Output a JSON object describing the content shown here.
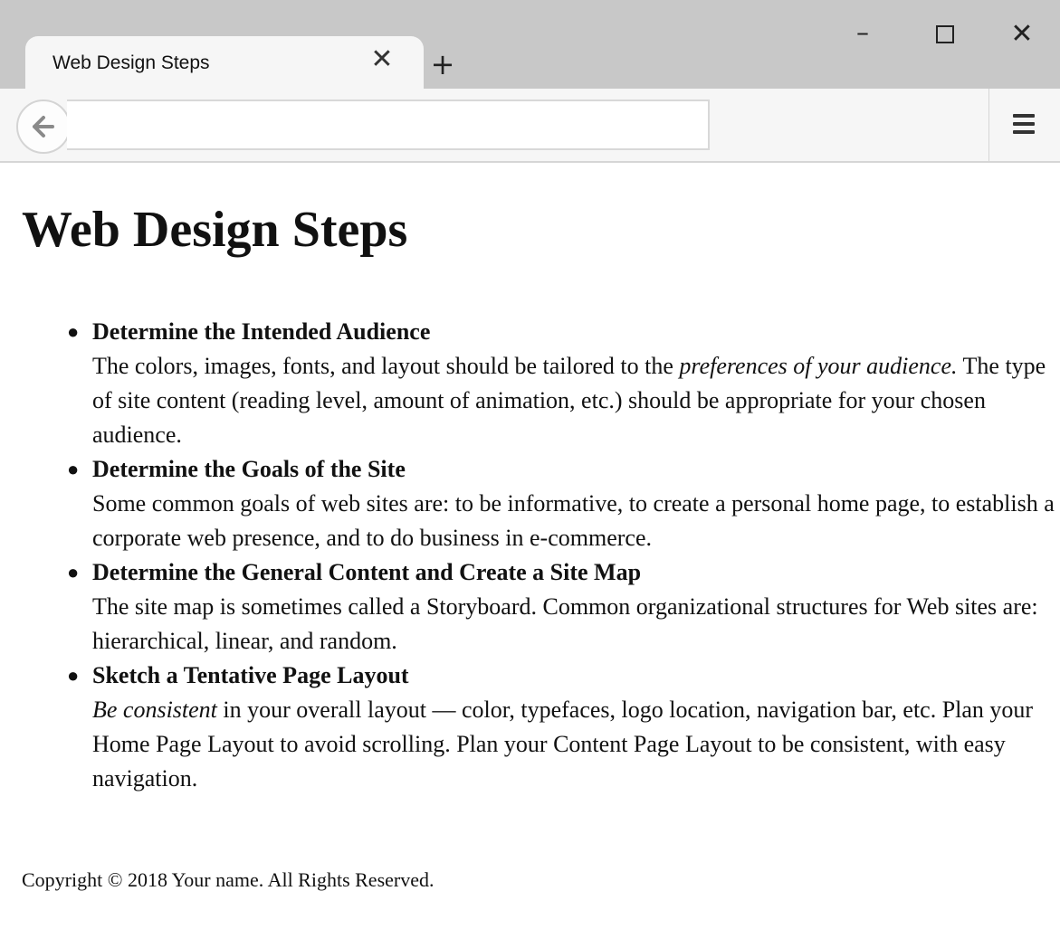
{
  "browser": {
    "tab_title": "Web Design Steps",
    "tab_close": "✕",
    "new_tab": "+",
    "min": "–",
    "close": "✕",
    "back": "🡐",
    "url": ""
  },
  "page": {
    "title": "Web Design Steps",
    "items": [
      {
        "head": "Determine the Intended Audience",
        "body_pre": "The colors, images, fonts, and layout should be tailored to the ",
        "body_em": "preferences of your audience.",
        "body_post": " The type of site content (reading level, amount of animation, etc.) should be appropriate for your chosen audience."
      },
      {
        "head": "Determine the Goals of the Site",
        "body_pre": "Some common goals of web sites are: to be informative, to create a personal home page, to establish a corporate web presence, and to do business in e-commerce.",
        "body_em": "",
        "body_post": ""
      },
      {
        "head": "Determine the General Content and Create a Site Map",
        "body_pre": "The site map is sometimes called a Storyboard. Common organizational structures for Web sites are: hierarchical, linear, and random.",
        "body_em": "",
        "body_post": ""
      },
      {
        "head": "Sketch a Tentative Page Layout",
        "body_pre": "",
        "body_em": "Be consistent",
        "body_post": " in your overall layout — color, typefaces, logo location, navigation bar, etc. Plan your Home Page Layout to avoid scrolling. Plan your Content Page Layout to be consistent, with easy navigation."
      }
    ],
    "footer": "Copyright © 2018 Your name. All Rights Reserved."
  }
}
